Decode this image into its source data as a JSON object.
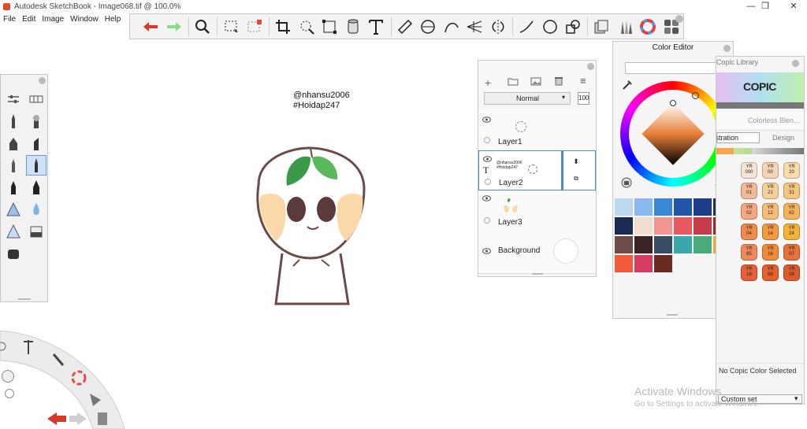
{
  "window": {
    "title": "Autodesk SketchBook - Image068.tif @ 100.0%",
    "minimize": "—",
    "maximize": "❒",
    "close": "✕"
  },
  "menu": [
    "File",
    "Edit",
    "Image",
    "Window",
    "Help"
  ],
  "toolbar": {
    "icons": [
      "undo-icon",
      "redo-icon",
      "zoom-icon",
      "select-icon",
      "crop-select-icon",
      "crop-icon",
      "lasso-icon",
      "transform-icon",
      "fill-icon",
      "text-icon",
      "ruler-icon",
      "ellipse-guide-icon",
      "curve-icon",
      "perspective-icon",
      "symmetry-icon",
      "stroke-icon",
      "circle-icon",
      "shapes-icon",
      "copy-icon",
      "brushes-icon",
      "color-wheel-icon",
      "layout-icon"
    ],
    "colors": {
      "undo": "#d43a2a",
      "redo": "#7fd67f",
      "accent": "#2b2b2b"
    }
  },
  "canvas": {
    "line1": "@nhansu2006",
    "line2": "#Hoidap247"
  },
  "layer_editor": {
    "blend_mode": "Normal",
    "opacity": "100",
    "layers": [
      {
        "name": "Layer1",
        "selected": false
      },
      {
        "name": "Layer2",
        "selected": true
      },
      {
        "name": "Layer3",
        "selected": false
      },
      {
        "name": "Background",
        "selected": false
      }
    ],
    "layer2_thumb_text": [
      "@nhansu2006",
      "#Hoidap247"
    ]
  },
  "color_editor": {
    "title": "Color Editor",
    "hex_value": "",
    "swatches": [
      "#bcd7ee",
      "#8ab8ef",
      "#3b87d6",
      "#2256a8",
      "#1d3d8a",
      "#1f3356",
      "#1b2a4f",
      "#f0dcd0",
      "#f0958f",
      "#e85a5f",
      "#c63b4c",
      "#972b2b",
      "#6e4a4a",
      "#3a2323",
      "#3a4c64",
      "#3aa8a8",
      "#4caa7a",
      "#f2a43a",
      "#f15a3c",
      "#d63b62",
      "#6b2a22"
    ],
    "current_color": "#5a3a1a"
  },
  "copic_library": {
    "title": "Copic Library",
    "logo": "COPIC",
    "blend_label": "Colorless Blen...",
    "tabs": [
      "Illustration",
      "Design"
    ],
    "status": "No Copic Color Selected",
    "set": "Custom set",
    "chips": [
      {
        "code": "YR\n000",
        "color": "#f7e4d4"
      },
      {
        "code": "YR\n00",
        "color": "#f7d3b6"
      },
      {
        "code": "YR\n20",
        "color": "#f8dcb0"
      },
      {
        "code": "YR\n01",
        "color": "#f3b996"
      },
      {
        "code": "YR\n21",
        "color": "#f6d09a"
      },
      {
        "code": "YR\n31",
        "color": "#f6c680"
      },
      {
        "code": "YR\n02",
        "color": "#f2a880"
      },
      {
        "code": "YR\n12",
        "color": "#f5bd78"
      },
      {
        "code": "YR\n82",
        "color": "#f4b35a"
      },
      {
        "code": "YR\n04",
        "color": "#ee8a4a"
      },
      {
        "code": "YR\n14",
        "color": "#f19a42"
      },
      {
        "code": "YR\n24",
        "color": "#f4b23a"
      },
      {
        "code": "YR\n65",
        "color": "#ec8a5a"
      },
      {
        "code": "YR\n16",
        "color": "#ef8a3a"
      },
      {
        "code": "YR\n07",
        "color": "#e8703a"
      },
      {
        "code": "YR\n18",
        "color": "#e5603a"
      },
      {
        "code": "YR\n68",
        "color": "#e4602e"
      },
      {
        "code": "YR\n09",
        "color": "#dd5a2e"
      }
    ]
  },
  "watermark": {
    "line1": "Activate Windows",
    "line2": "Go to Settings to activate Windows."
  }
}
